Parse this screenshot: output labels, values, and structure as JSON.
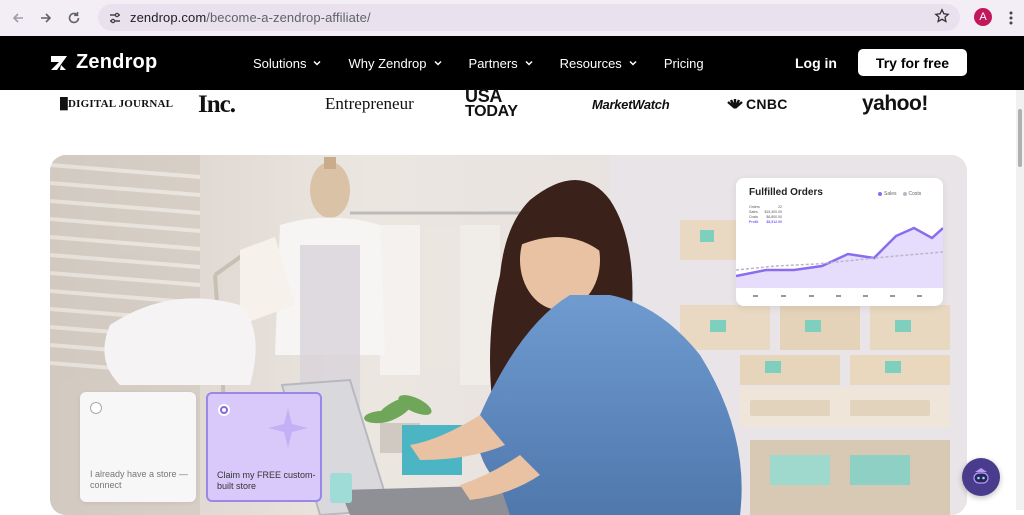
{
  "browser": {
    "url_host": "zendrop.com",
    "url_path": "/become-a-zendrop-affiliate/",
    "profile_initial": "A"
  },
  "nav": {
    "logo_text": "Zendrop",
    "menu": [
      {
        "label": "Solutions",
        "has_dropdown": true
      },
      {
        "label": "Why Zendrop",
        "has_dropdown": true
      },
      {
        "label": "Partners",
        "has_dropdown": true
      },
      {
        "label": "Resources",
        "has_dropdown": true
      },
      {
        "label": "Pricing",
        "has_dropdown": false
      }
    ],
    "login_label": "Log in",
    "cta_label": "Try for free"
  },
  "press": {
    "digital_journal": "DIGITAL JOURNAL",
    "inc": "Inc.",
    "entrepreneur": "Entrepreneur",
    "usa_today_1": "USA",
    "usa_today_2": "TODAY",
    "marketwatch": "MarketWatch",
    "cnbc": "CNBC",
    "yahoo": "yahoo!"
  },
  "hero": {
    "chart_card": {
      "title": "Fulfilled Orders",
      "legend": [
        "Sales",
        "Costs"
      ],
      "colors": {
        "sales": "#8a6cf0",
        "costs": "#b8b8c8"
      },
      "table": [
        {
          "label": "Orders",
          "value": "22"
        },
        {
          "label": "Sales",
          "value": "$15,300.00"
        },
        {
          "label": "Costs",
          "value": "$6,800.00"
        },
        {
          "label": "Profit",
          "value": "$8,512.00"
        }
      ]
    },
    "options": [
      {
        "label": "I already have a store — connect",
        "selected": false
      },
      {
        "label": "Claim my FREE custom-built store",
        "selected": true
      }
    ]
  },
  "colors": {
    "accent": "#8466e6",
    "nav_bg": "#000000"
  }
}
